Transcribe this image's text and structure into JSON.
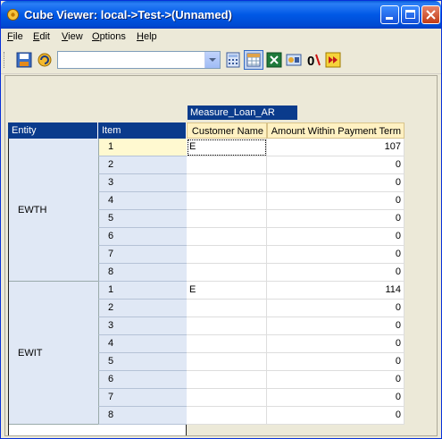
{
  "window": {
    "title": "Cube Viewer: local->Test->(Unnamed)"
  },
  "menu": [
    {
      "label": "File",
      "accel": "F"
    },
    {
      "label": "Edit",
      "accel": "E"
    },
    {
      "label": "View",
      "accel": "V"
    },
    {
      "label": "Options",
      "accel": "O"
    },
    {
      "label": "Help",
      "accel": "H"
    }
  ],
  "toolbar": {
    "view_select_value": "",
    "icons": [
      "save-icon",
      "recalculate-icon",
      "dropdown-arrow-icon",
      "calculator-icon",
      "spreadsheet-icon",
      "excel-icon",
      "subset-editor-icon",
      "zero-suppress-icon",
      "next-icon"
    ]
  },
  "grid": {
    "measure_header": "Measure_Loan_AR",
    "row_headers": [
      "Entity",
      "Item"
    ],
    "column_headers": [
      "Customer Name",
      "Amount Within Payment Term"
    ],
    "groups": [
      {
        "entity": "EWTH",
        "rows": [
          {
            "item": "1",
            "customer": "E",
            "amount": "107"
          },
          {
            "item": "2",
            "customer": "",
            "amount": "0"
          },
          {
            "item": "3",
            "customer": "",
            "amount": "0"
          },
          {
            "item": "4",
            "customer": "",
            "amount": "0"
          },
          {
            "item": "5",
            "customer": "",
            "amount": "0"
          },
          {
            "item": "6",
            "customer": "",
            "amount": "0"
          },
          {
            "item": "7",
            "customer": "",
            "amount": "0"
          },
          {
            "item": "8",
            "customer": "",
            "amount": "0"
          }
        ]
      },
      {
        "entity": "EWIT",
        "rows": [
          {
            "item": "1",
            "customer": "E",
            "amount": "114"
          },
          {
            "item": "2",
            "customer": "",
            "amount": "0"
          },
          {
            "item": "3",
            "customer": "",
            "amount": "0"
          },
          {
            "item": "4",
            "customer": "",
            "amount": "0"
          },
          {
            "item": "5",
            "customer": "",
            "amount": "0"
          },
          {
            "item": "6",
            "customer": "",
            "amount": "0"
          },
          {
            "item": "7",
            "customer": "",
            "amount": "0"
          },
          {
            "item": "8",
            "customer": "",
            "amount": "0"
          }
        ]
      }
    ]
  }
}
